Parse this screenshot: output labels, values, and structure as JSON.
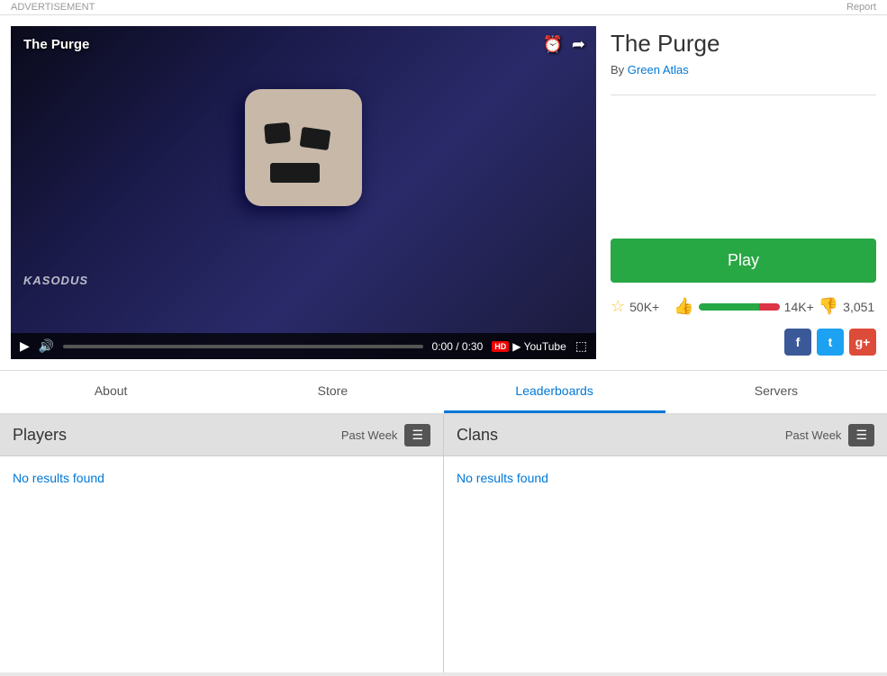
{
  "topBar": {
    "advertisement": "ADVERTISEMENT",
    "report": "Report"
  },
  "game": {
    "title": "The Purge",
    "author": "Green Atlas",
    "videoTitle": "The Purge",
    "watermark": "KASODUS",
    "playLabel": "Play",
    "stats": {
      "favorites": "50K+",
      "likes": "14K+",
      "dislikes": "3,051"
    },
    "time": {
      "current": "0:00",
      "total": "0:30",
      "display": "0:00 / 0:30"
    }
  },
  "tabs": [
    {
      "id": "about",
      "label": "About",
      "active": false
    },
    {
      "id": "store",
      "label": "Store",
      "active": false
    },
    {
      "id": "leaderboards",
      "label": "Leaderboards",
      "active": true
    },
    {
      "id": "servers",
      "label": "Servers",
      "active": false
    }
  ],
  "leaderboard": {
    "players": {
      "title": "Players",
      "period": "Past Week",
      "noResults": "No results found"
    },
    "clans": {
      "title": "Clans",
      "period": "Past Week",
      "noResults": "No results found"
    }
  }
}
